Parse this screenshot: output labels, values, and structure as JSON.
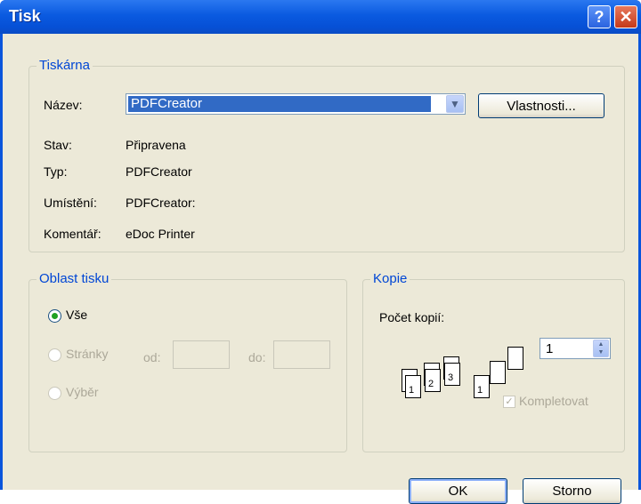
{
  "window": {
    "title": "Tisk"
  },
  "printer": {
    "group_label": "Tiskárna",
    "name_label": "Název:",
    "selected": "PDFCreator",
    "properties_button": "Vlastnosti...",
    "status_label": "Stav:",
    "status_value": "Připravena",
    "type_label": "Typ:",
    "type_value": "PDFCreator",
    "location_label": "Umístění:",
    "location_value": "PDFCreator:",
    "comment_label": "Komentář:",
    "comment_value": "eDoc Printer"
  },
  "print_range": {
    "group_label": "Oblast tisku",
    "all_label": "Vše",
    "pages_label": "Stránky",
    "from_label": "od:",
    "to_label": "do:",
    "selection_label": "Výběr",
    "selected_option": "all"
  },
  "copies": {
    "group_label": "Kopie",
    "count_label": "Počet kopií:",
    "count_value": "1",
    "collate_label": "Kompletovat",
    "collate_checked": true
  },
  "buttons": {
    "ok": "OK",
    "cancel": "Storno"
  }
}
